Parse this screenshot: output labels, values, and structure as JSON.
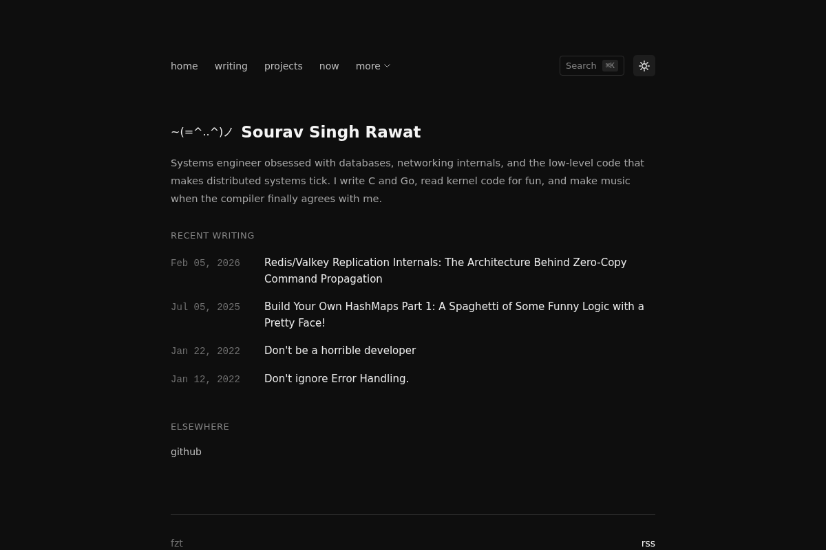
{
  "nav": {
    "items": [
      {
        "label": "home",
        "kind": "link"
      },
      {
        "label": "writing",
        "kind": "link"
      },
      {
        "label": "projects",
        "kind": "link"
      },
      {
        "label": "now",
        "kind": "link"
      },
      {
        "label": "more",
        "kind": "menu"
      }
    ],
    "search": {
      "label": "Search",
      "shortcut": "⌘K"
    }
  },
  "intro": {
    "kaomoji": "~(=^..^)ノ",
    "name": "Sourav Singh Rawat",
    "bio": "Systems engineer obsessed with databases, networking internals, and the low-level code that makes distributed systems tick. I write C and Go, read kernel code for fun, and make music when the compiler finally agrees with me."
  },
  "recent_writing": {
    "heading": "RECENT WRITING",
    "posts": [
      {
        "date": "Feb 05, 2026",
        "title": "Redis/Valkey Replication Internals: The Architecture Behind Zero-Copy Command Propagation"
      },
      {
        "date": "Jul 05, 2025",
        "title": "Build Your Own HashMaps Part 1: A Spaghetti of Some Funny Logic with a Pretty Face!"
      },
      {
        "date": "Jan 22, 2022",
        "title": "Don't be a horrible developer"
      },
      {
        "date": "Jan 12, 2022",
        "title": "Don't ignore Error Handling."
      }
    ]
  },
  "elsewhere": {
    "heading": "ELSEWHERE",
    "links": [
      {
        "label": "github"
      }
    ]
  },
  "footer": {
    "left": "fzt",
    "right": "rss"
  }
}
